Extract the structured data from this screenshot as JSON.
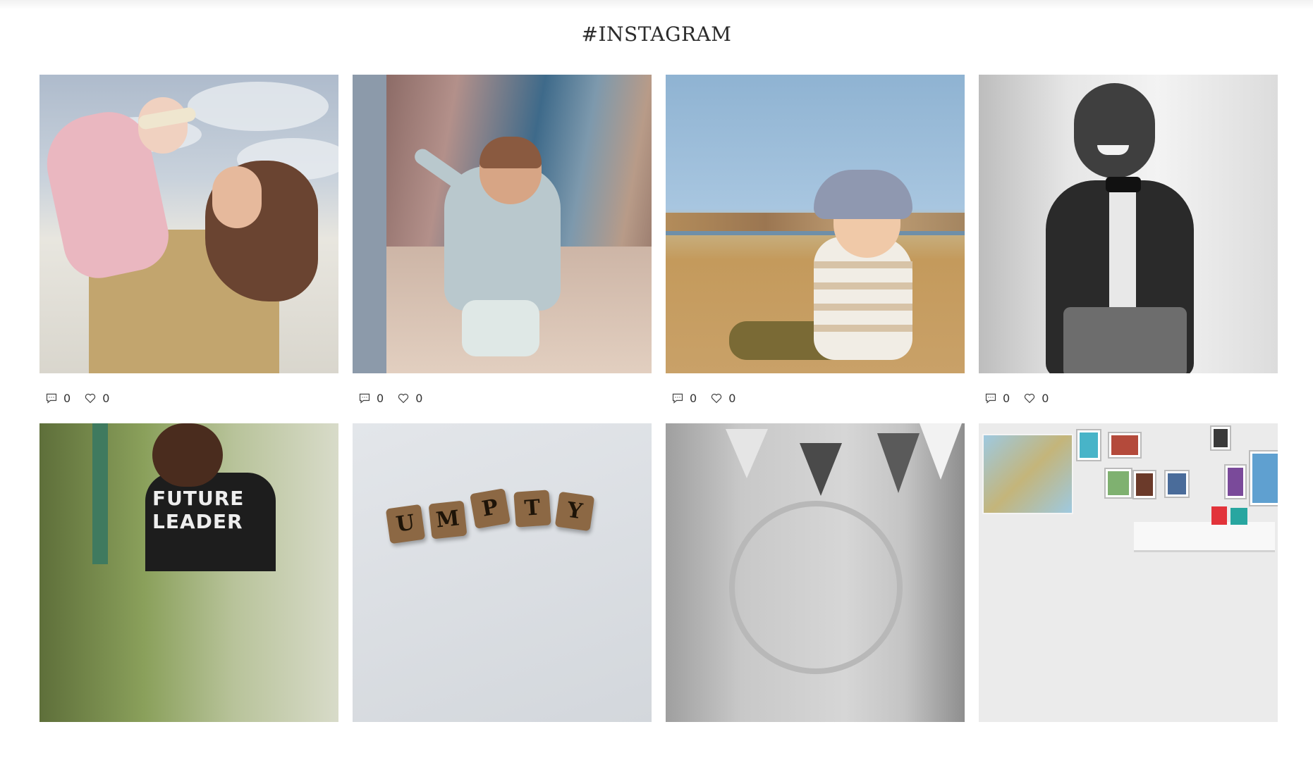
{
  "section": {
    "title": "#INSTAGRAM"
  },
  "posts": [
    {
      "comments": "0",
      "likes": "0"
    },
    {
      "comments": "0",
      "likes": "0"
    },
    {
      "comments": "0",
      "likes": "0"
    },
    {
      "comments": "0",
      "likes": "0"
    },
    {
      "comments": "",
      "likes": ""
    },
    {
      "comments": "",
      "likes": ""
    },
    {
      "comments": "",
      "likes": ""
    },
    {
      "comments": "",
      "likes": ""
    }
  ],
  "photo_text": {
    "shirt": "FUTURE LEADER",
    "tiles": [
      "U",
      "M",
      "P",
      "T",
      "Y"
    ]
  },
  "icons": {
    "comment": "comment-icon",
    "like": "heart-icon"
  }
}
